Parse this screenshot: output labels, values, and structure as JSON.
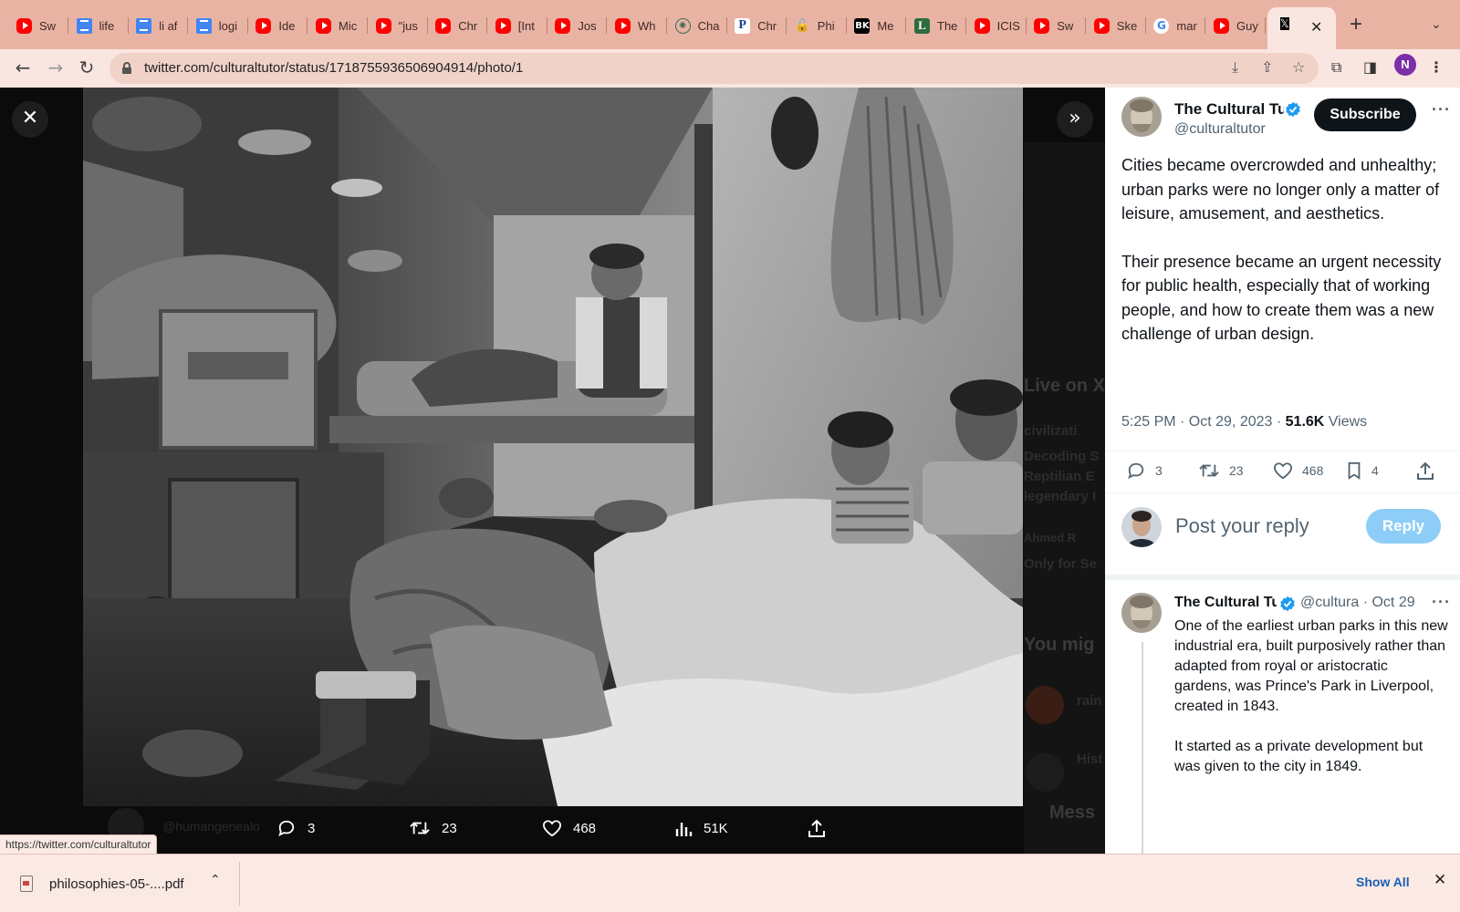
{
  "browser": {
    "tabs": [
      {
        "title": "Sw",
        "icon": "youtube-icon"
      },
      {
        "title": "life",
        "icon": "google-docs-icon"
      },
      {
        "title": "li af",
        "icon": "google-docs-icon"
      },
      {
        "title": "logi",
        "icon": "google-docs-icon"
      },
      {
        "title": "Ide",
        "icon": "youtube-icon"
      },
      {
        "title": "Mic",
        "icon": "youtube-icon"
      },
      {
        "title": "\"jus",
        "icon": "youtube-icon"
      },
      {
        "title": "Chr",
        "icon": "youtube-icon"
      },
      {
        "title": "[Int",
        "icon": "youtube-icon"
      },
      {
        "title": "Jos",
        "icon": "youtube-icon"
      },
      {
        "title": "Wh",
        "icon": "youtube-icon"
      },
      {
        "title": "Cha",
        "icon": "chatgpt-icon"
      },
      {
        "title": "Chr",
        "icon": "pp-icon"
      },
      {
        "title": "Phi",
        "icon": "lock-icon"
      },
      {
        "title": "Me",
        "icon": "bk-icon"
      },
      {
        "title": "The",
        "icon": "letter-l-icon"
      },
      {
        "title": "ICIS",
        "icon": "youtube-icon"
      },
      {
        "title": "Sw",
        "icon": "youtube-icon"
      },
      {
        "title": "Ske",
        "icon": "youtube-icon"
      },
      {
        "title": "mar",
        "icon": "google-icon"
      },
      {
        "title": "Guy",
        "icon": "youtube-icon"
      }
    ],
    "active_tab_icon": "x-logo-icon",
    "url": "twitter.com/culturaltutor/status/1718755936506904914/photo/1",
    "profile_initial": "N",
    "status_link": "https://twitter.com/culturaltutor"
  },
  "viewer": {
    "actions": {
      "replies": "3",
      "retweets": "23",
      "likes": "468",
      "views": "51K"
    },
    "ghost": {
      "live": "Live on X",
      "civ": "civilizati",
      "decoding": "Decoding S",
      "reptilian": "Reptilian E",
      "legendary": "legendary I",
      "ahmed": "Ahmed R",
      "only_for": "Only for Se",
      "you_might": "You mig",
      "messages": "Mess",
      "user_handle": "@humangenealo",
      "rain": "rain",
      "his": "Hist"
    }
  },
  "tweet": {
    "author_name": "The Cultural Tutor",
    "author_handle": "@culturaltutor",
    "subscribe_label": "Subscribe",
    "paragraph_1": "Cities became overcrowded and unhealthy; urban parks were no longer only a matter of leisure, amusement, and aesthetics.",
    "paragraph_2": "Their presence became an urgent necessity for public health, especially that of working people, and how to create them was a new challenge of urban design.",
    "time": "5:25 PM · Oct 29, 2023 · ",
    "views_count": "51.6K",
    "views_label": " Views",
    "stats": {
      "replies": "3",
      "retweets": "23",
      "likes": "468",
      "bookmarks": "4"
    },
    "reply_placeholder": "Post your reply",
    "reply_button": "Reply"
  },
  "thread_reply": {
    "author_name": "The Cultural Tutor",
    "handle_time": "@cultura · Oct 29",
    "paragraph_1": "One of the earliest urban parks in this new industrial era, built purposively rather than adapted from royal or aristocratic gardens, was Prince's Park in Liverpool, created in 1843.",
    "paragraph_2": "It started as a private development but was given to the city in 1849."
  },
  "downloads": {
    "file_name": "philosophies-05-....pdf",
    "show_all": "Show All"
  },
  "colors": {
    "tab_strip": "#e9b3a3",
    "toolbar": "#fae6e0",
    "twitter_blue": "#1d9bf0",
    "subscribe_bg": "#0f1419",
    "reply_button_bg": "#8ecdf7"
  }
}
